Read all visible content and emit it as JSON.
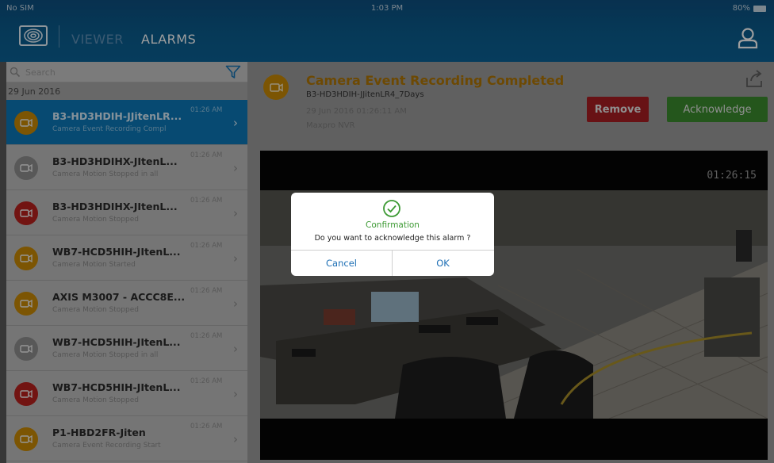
{
  "status_bar": {
    "carrier": "No SIM",
    "time": "1:03 PM",
    "battery": "80%"
  },
  "nav": {
    "viewer_label": "VIEWER",
    "alarms_label": "ALARMS"
  },
  "sidebar": {
    "search_placeholder": "Search",
    "date_header": "29 Jun 2016",
    "items": [
      {
        "title": "B3-HD3HDIH-JJitenLR...",
        "subtitle": "Camera Event Recording Compl",
        "time": "01:26 AM",
        "badge_color": "orange",
        "selected": true
      },
      {
        "title": "B3-HD3HDIHX-JItenL...",
        "subtitle": "Camera Motion Stopped in all",
        "time": "01:26 AM",
        "badge_color": "gray"
      },
      {
        "title": "B3-HD3HDIHX-JItenL...",
        "subtitle": "Camera Motion Stopped",
        "time": "01:26 AM",
        "badge_color": "red"
      },
      {
        "title": "WB7-HCD5HIH-JItenL...",
        "subtitle": "Camera Motion Started",
        "time": "01:26 AM",
        "badge_color": "orange"
      },
      {
        "title": "AXIS M3007 - ACCC8E...",
        "subtitle": "Camera Motion Stopped",
        "time": "01:26 AM",
        "badge_color": "orange"
      },
      {
        "title": "WB7-HCD5HIH-JItenL...",
        "subtitle": "Camera Motion Stopped in all",
        "time": "01:26 AM",
        "badge_color": "gray"
      },
      {
        "title": "WB7-HCD5HIH-JItenL...",
        "subtitle": "Camera Motion Stopped",
        "time": "01:26 AM",
        "badge_color": "red"
      },
      {
        "title": "P1-HBD2FR-Jiten",
        "subtitle": "Camera Event Recording Start",
        "time": "01:26 AM",
        "badge_color": "orange"
      }
    ]
  },
  "detail": {
    "title": "Camera Event Recording Completed",
    "camera": "B3-HD3HDIH-JJitenLR4_7Days",
    "datetime": "29 Jun 2016 01:26:11 AM",
    "source": "Maxpro NVR",
    "remove_label": "Remove",
    "acknowledge_label": "Acknowledge",
    "video_timestamp": "01:26:15"
  },
  "dialog": {
    "title": "Confirmation",
    "message": "Do you want to acknowledge this alarm ?",
    "cancel_label": "Cancel",
    "ok_label": "OK"
  },
  "colors": {
    "nav_bg": "#0b5a8c",
    "selected_row": "#0c78b8",
    "badge_orange": "#c98a05",
    "badge_gray": "#8e8e8e",
    "badge_red": "#b8211d",
    "remove_button": "#a81e22",
    "acknowledge_button": "#3b8b2e",
    "dialog_accent": "#3d9a34",
    "dialog_button_text": "#1d6fb5"
  }
}
